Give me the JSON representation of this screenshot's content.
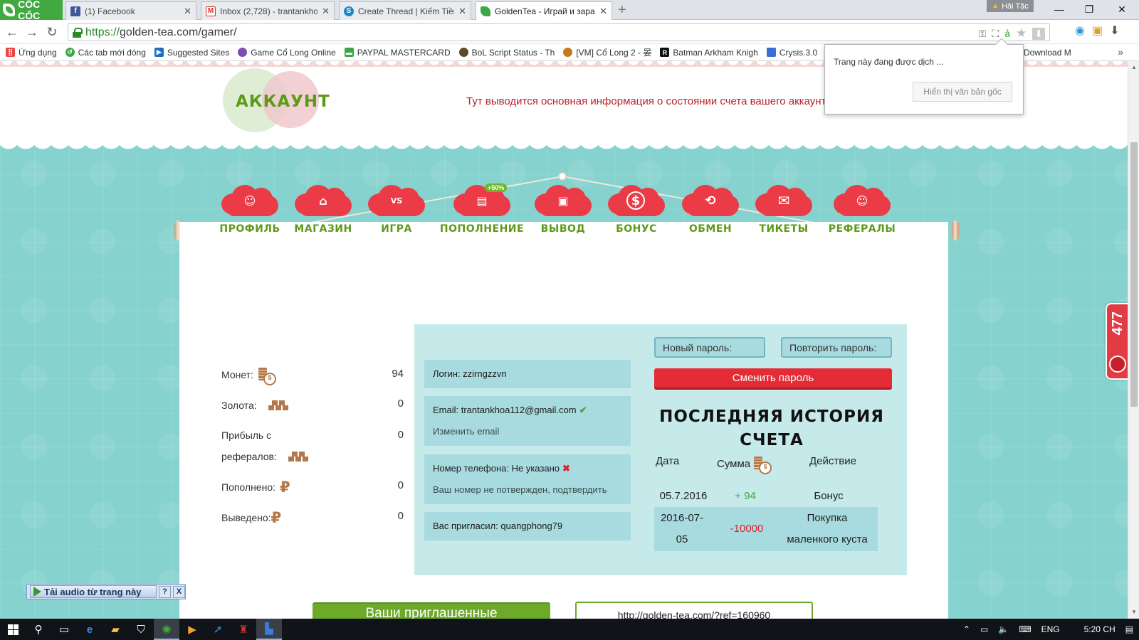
{
  "browser": {
    "brand": "CỐC CỐC",
    "tabs": [
      {
        "title": "(1) Facebook",
        "icon": "facebook-icon",
        "color": "#3b5998"
      },
      {
        "title": "Inbox (2,728) - trantankhoa",
        "icon": "gmail-icon",
        "color": "#d93025"
      },
      {
        "title": "Create Thread | Kiếm Tiền",
        "icon": "forum-icon",
        "color": "#1b87c9"
      },
      {
        "title": "GoldenTea - Играй и зараб",
        "icon": "goldentea-icon",
        "color": "#3fa645"
      }
    ],
    "profile_name": "Hải Tặc",
    "url_scheme": "https://",
    "url_rest": "golden-tea.com/gamer/",
    "bookmarks": [
      {
        "label": "Ứng dụng",
        "icon": "apps-icon",
        "color": "#e44"
      },
      {
        "label": "Các tab mới đóng",
        "icon": "history-icon",
        "color": "#3fa645"
      },
      {
        "label": "Suggested Sites",
        "icon": "suggested-icon",
        "color": "#1e6fc4"
      },
      {
        "label": "Game Cổ Long Online",
        "icon": "game-icon",
        "color": "#7a4fb3"
      },
      {
        "label": "PAYPAL MASTERCARD",
        "icon": "card-icon",
        "color": "#3fa645"
      },
      {
        "label": "BoL Script Status - Th",
        "icon": "bol-icon",
        "color": "#5c4a2a"
      },
      {
        "label": "[VM] Cổ Long 2 - 晏",
        "icon": "vm-icon",
        "color": "#c47b1e"
      },
      {
        "label": "Batman Arkham Knigh",
        "icon": "batman-icon",
        "color": "#111"
      },
      {
        "label": "Crysis.3.0",
        "icon": "doc-icon",
        "color": "#3b6ed8"
      },
      {
        "label": "Download M",
        "icon": "download-icon",
        "color": "#888"
      }
    ],
    "translate_popup": {
      "message": "Trang này đang được dịch ...",
      "button": "Hiển thị văn bản gốc"
    }
  },
  "page": {
    "section_title": "АККАУНТ",
    "section_subtitle": "Тут выводится основная информация о состоянии счета вашего аккаунта.",
    "nav": [
      {
        "label": "ПРОФИЛЬ",
        "icon": "profile-icon",
        "glyph": "👤"
      },
      {
        "label": "МАГАЗИН",
        "icon": "shop-icon",
        "glyph": "🏪"
      },
      {
        "label": "ИГРА",
        "icon": "game-vs-icon",
        "glyph": "VS"
      },
      {
        "label": "ПОПОЛНЕНИЕ",
        "icon": "deposit-icon",
        "glyph": "▤",
        "promo": "+50%"
      },
      {
        "label": "ВЫВОД",
        "icon": "wallet-icon",
        "glyph": "▣"
      },
      {
        "label": "БОНУС",
        "icon": "dollar-icon",
        "glyph": "$"
      },
      {
        "label": "ОБМЕН",
        "icon": "exchange-icon",
        "glyph": "⟲"
      },
      {
        "label": "ТИКЕТЫ",
        "icon": "mail-icon",
        "glyph": "✉"
      },
      {
        "label": "РЕФЕРАЛЫ",
        "icon": "referrals-icon",
        "glyph": "👤"
      }
    ],
    "stats": [
      {
        "label": "Монет:",
        "icon": "coins-icon",
        "value": "94"
      },
      {
        "label": "Золота:",
        "icon": "gold-icon",
        "value": "0"
      },
      {
        "label": "Прибыль с",
        "label2": "рефералов:",
        "icon": "gold-icon",
        "value": "0"
      },
      {
        "label": "Пополнено:",
        "icon": "ruble-icon",
        "value": "0"
      },
      {
        "label": "Выведено:",
        "icon": "ruble-icon",
        "value": "0"
      }
    ],
    "account": {
      "login": "Логин: zzirngzzvn",
      "email": "Email: trantankhoa112@gmail.com",
      "change_email": "Изменить email",
      "phone": "Номер телефона: Не указано",
      "phone_note": "Ваш номер не потвержден, подтвердить",
      "invited_by": "Вас пригласил: quangphong79"
    },
    "password": {
      "new_placeholder": "Новый пароль:",
      "repeat_placeholder": "Повторить пароль:",
      "change_button": "Сменить пароль"
    },
    "history": {
      "title_line1": "ПОСЛЕДНЯЯ ИСТОРИЯ",
      "title_line2": "СЧЕТА",
      "col_date": "Дата",
      "col_amount": "Сумма",
      "col_action": "Действие",
      "rows": [
        {
          "date": "05.7.2016",
          "amount": "+ 94",
          "action": "Бонус"
        },
        {
          "date_line1": "2016-07-",
          "date_line2": "05",
          "amount": "-10000",
          "action_line1": "Покупка",
          "action_line2": "маленкого куста"
        }
      ]
    },
    "invited_button": "Ваши приглашенные",
    "ref_link": "http://golden-tea.com/?ref=160960",
    "side_counter": "477",
    "audio_bar": {
      "label": "Tải audio từ trang này",
      "help": "?",
      "close": "X"
    }
  },
  "taskbar": {
    "lang": "ENG",
    "time": "5:20 CH"
  }
}
